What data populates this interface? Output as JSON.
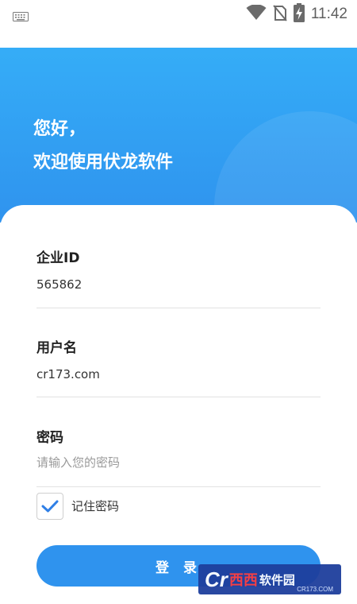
{
  "status_bar": {
    "time": "11:42",
    "icons": [
      "keyboard-icon",
      "wifi-icon",
      "no-sim-icon",
      "battery-charging-icon"
    ]
  },
  "header": {
    "greeting_line1": "您好，",
    "greeting_line2": "欢迎使用伏龙软件"
  },
  "form": {
    "company_id": {
      "label": "企业ID",
      "value": "565862"
    },
    "username": {
      "label": "用户名",
      "value": "cr173.com"
    },
    "password": {
      "label": "密码",
      "placeholder": "请输入您的密码",
      "value": ""
    },
    "remember": {
      "label": "记住密码",
      "checked": true
    },
    "login_label": "登 录"
  },
  "watermark": {
    "cr": "Cr",
    "red": "西西",
    "white": "软件园",
    "url": "CR173.COM"
  },
  "colors": {
    "primary": "#2f93ee",
    "banner_top": "#35adf7",
    "check": "#2f7fe6"
  }
}
